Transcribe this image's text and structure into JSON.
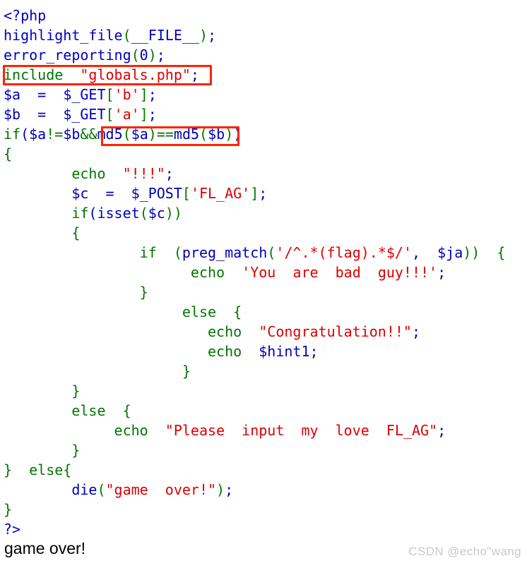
{
  "page": {
    "title": "PHP source highlight_file output",
    "background": "#ffffff",
    "output_text": "game over!",
    "watermark": "CSDN @echo\"wang"
  },
  "colors": {
    "keyword_green": "#007700",
    "string_red": "#DD0000",
    "variable_blue": "#0000BB",
    "default_blue": "#0000BB",
    "annotation_red": "#FF2200",
    "output_black": "#000000",
    "watermark_gray": "#c9c9c9"
  },
  "annotations": [
    {
      "id": "annot-include",
      "label": "include-globals-highlight",
      "target_text": "include \"globals.php\";"
    },
    {
      "id": "annot-md5",
      "label": "md5-compare-highlight",
      "target_text": "md5($a)==md5($b)"
    }
  ],
  "code": {
    "language": "php",
    "lines": [
      {
        "n": 1,
        "tokens": [
          {
            "c": "p",
            "t": "<?php"
          }
        ]
      },
      {
        "n": 2,
        "tokens": [
          {
            "c": "v",
            "t": "highlight_file"
          },
          {
            "c": "k",
            "t": "("
          },
          {
            "c": "v",
            "t": "__FILE__"
          },
          {
            "c": "k",
            "t": ")"
          },
          {
            "c": "d",
            "t": ";"
          }
        ]
      },
      {
        "n": 3,
        "tokens": [
          {
            "c": "v",
            "t": "error_reporting"
          },
          {
            "c": "k",
            "t": "("
          },
          {
            "c": "v",
            "t": "0"
          },
          {
            "c": "k",
            "t": ")"
          },
          {
            "c": "d",
            "t": ";"
          }
        ]
      },
      {
        "n": 4,
        "tokens": [
          {
            "c": "k",
            "t": "include  "
          },
          {
            "c": "s",
            "t": "\"globals.php\""
          },
          {
            "c": "d",
            "t": ";"
          }
        ]
      },
      {
        "n": 5,
        "tokens": [
          {
            "c": "v",
            "t": "$a"
          },
          {
            "c": "d",
            "t": "  =  "
          },
          {
            "c": "v",
            "t": "$_GET"
          },
          {
            "c": "k",
            "t": "["
          },
          {
            "c": "s",
            "t": "'b'"
          },
          {
            "c": "k",
            "t": "]"
          },
          {
            "c": "d",
            "t": ";"
          }
        ]
      },
      {
        "n": 6,
        "tokens": [
          {
            "c": "v",
            "t": "$b"
          },
          {
            "c": "d",
            "t": "  =  "
          },
          {
            "c": "v",
            "t": "$_GET"
          },
          {
            "c": "k",
            "t": "["
          },
          {
            "c": "s",
            "t": "'a'"
          },
          {
            "c": "k",
            "t": "]"
          },
          {
            "c": "d",
            "t": ";"
          }
        ]
      },
      {
        "n": 7,
        "tokens": [
          {
            "c": "k",
            "t": "if"
          },
          {
            "c": "d",
            "t": "("
          },
          {
            "c": "v",
            "t": "$a"
          },
          {
            "c": "k",
            "t": "!="
          },
          {
            "c": "v",
            "t": "$b"
          },
          {
            "c": "k",
            "t": "&&"
          },
          {
            "c": "v",
            "t": "md5"
          },
          {
            "c": "k",
            "t": "("
          },
          {
            "c": "v",
            "t": "$a"
          },
          {
            "c": "k",
            "t": ")"
          },
          {
            "c": "k",
            "t": "=="
          },
          {
            "c": "v",
            "t": "md5"
          },
          {
            "c": "k",
            "t": "("
          },
          {
            "c": "v",
            "t": "$b"
          },
          {
            "c": "k",
            "t": ")"
          },
          {
            "c": "d",
            "t": ")"
          }
        ]
      },
      {
        "n": 8,
        "tokens": [
          {
            "c": "k",
            "t": "{"
          }
        ]
      },
      {
        "n": 9,
        "tokens": [
          {
            "c": "d",
            "t": "        "
          },
          {
            "c": "k",
            "t": "echo  "
          },
          {
            "c": "s",
            "t": "\"!!!\""
          },
          {
            "c": "d",
            "t": ";"
          }
        ]
      },
      {
        "n": 10,
        "tokens": [
          {
            "c": "d",
            "t": "        "
          },
          {
            "c": "v",
            "t": "$c"
          },
          {
            "c": "d",
            "t": "  =  "
          },
          {
            "c": "v",
            "t": "$_POST"
          },
          {
            "c": "k",
            "t": "["
          },
          {
            "c": "s",
            "t": "'FL_AG'"
          },
          {
            "c": "k",
            "t": "]"
          },
          {
            "c": "d",
            "t": ";"
          }
        ]
      },
      {
        "n": 11,
        "tokens": [
          {
            "c": "d",
            "t": "        "
          },
          {
            "c": "k",
            "t": "if"
          },
          {
            "c": "d",
            "t": "("
          },
          {
            "c": "v",
            "t": "isset"
          },
          {
            "c": "k",
            "t": "("
          },
          {
            "c": "v",
            "t": "$c"
          },
          {
            "c": "k",
            "t": "))"
          }
        ]
      },
      {
        "n": 12,
        "tokens": [
          {
            "c": "d",
            "t": "        "
          },
          {
            "c": "k",
            "t": "{"
          }
        ]
      },
      {
        "n": 13,
        "tokens": [
          {
            "c": "d",
            "t": "                "
          },
          {
            "c": "k",
            "t": "if  ("
          },
          {
            "c": "v",
            "t": "preg_match"
          },
          {
            "c": "k",
            "t": "("
          },
          {
            "c": "s",
            "t": "'/^.*(flag).*$/'"
          },
          {
            "c": "d",
            "t": ",  "
          },
          {
            "c": "v",
            "t": "$ja"
          },
          {
            "c": "k",
            "t": "))  {"
          }
        ]
      },
      {
        "n": 14,
        "tokens": [
          {
            "c": "d",
            "t": "                      "
          },
          {
            "c": "k",
            "t": "echo  "
          },
          {
            "c": "s",
            "t": "'You  are  bad  guy!!!'"
          },
          {
            "c": "d",
            "t": ";"
          }
        ]
      },
      {
        "n": 15,
        "tokens": [
          {
            "c": "d",
            "t": "                "
          },
          {
            "c": "k",
            "t": "}"
          }
        ]
      },
      {
        "n": 16,
        "tokens": [
          {
            "c": "d",
            "t": "                     "
          },
          {
            "c": "k",
            "t": "else  {"
          }
        ]
      },
      {
        "n": 17,
        "tokens": [
          {
            "c": "d",
            "t": "                        "
          },
          {
            "c": "k",
            "t": "echo  "
          },
          {
            "c": "s",
            "t": "\"Congratulation!!\""
          },
          {
            "c": "d",
            "t": ";"
          }
        ]
      },
      {
        "n": 18,
        "tokens": [
          {
            "c": "d",
            "t": "                        "
          },
          {
            "c": "k",
            "t": "echo  "
          },
          {
            "c": "v",
            "t": "$hint1"
          },
          {
            "c": "d",
            "t": ";"
          }
        ]
      },
      {
        "n": 19,
        "tokens": [
          {
            "c": "d",
            "t": "                     "
          },
          {
            "c": "k",
            "t": "}"
          }
        ]
      },
      {
        "n": 20,
        "tokens": [
          {
            "c": "d",
            "t": "        "
          },
          {
            "c": "k",
            "t": "}"
          }
        ]
      },
      {
        "n": 21,
        "tokens": [
          {
            "c": "d",
            "t": "        "
          },
          {
            "c": "k",
            "t": "else  {"
          }
        ]
      },
      {
        "n": 22,
        "tokens": [
          {
            "c": "d",
            "t": "             "
          },
          {
            "c": "k",
            "t": "echo  "
          },
          {
            "c": "s",
            "t": "\"Please  input  my  love  FL_AG\""
          },
          {
            "c": "d",
            "t": ";"
          }
        ]
      },
      {
        "n": 23,
        "tokens": [
          {
            "c": "d",
            "t": "        "
          },
          {
            "c": "k",
            "t": "}"
          }
        ]
      },
      {
        "n": 24,
        "tokens": [
          {
            "c": "k",
            "t": "}  else{"
          }
        ]
      },
      {
        "n": 25,
        "tokens": [
          {
            "c": "d",
            "t": "        "
          },
          {
            "c": "v",
            "t": "die"
          },
          {
            "c": "k",
            "t": "("
          },
          {
            "c": "s",
            "t": "\"game  over!\""
          },
          {
            "c": "k",
            "t": ")"
          },
          {
            "c": "d",
            "t": ";"
          }
        ]
      },
      {
        "n": 26,
        "tokens": [
          {
            "c": "k",
            "t": "}"
          }
        ]
      },
      {
        "n": 27,
        "tokens": [
          {
            "c": "p",
            "t": "?>"
          }
        ]
      }
    ]
  }
}
